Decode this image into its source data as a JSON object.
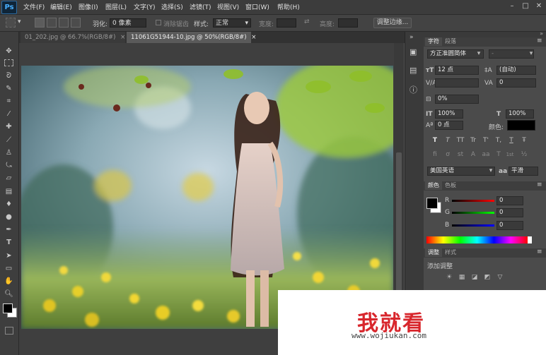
{
  "app": {
    "logo": "Ps"
  },
  "menu": [
    "文件(F)",
    "编辑(E)",
    "图像(I)",
    "图层(L)",
    "文字(Y)",
    "选择(S)",
    "滤镜(T)",
    "视图(V)",
    "窗口(W)",
    "帮助(H)"
  ],
  "window_controls": {
    "minimize": "–",
    "maximize": "□",
    "close": "✕"
  },
  "options": {
    "feather_label": "羽化:",
    "feather_value": "0 像素",
    "antialias_label": "消除锯齿",
    "style_label": "样式:",
    "style_value": "正常",
    "width_label": "宽度:",
    "height_label": "高度:",
    "refine_edge": "调整边缘..."
  },
  "tabs": [
    {
      "label": "01_202.jpg @ 66.7%(RGB/8#)",
      "close": "×"
    },
    {
      "label": "11061G51944-10.jpg @ 50%(RGB/8#)",
      "close": "×"
    }
  ],
  "character": {
    "tabs": [
      "字符",
      "段落"
    ],
    "font_family": "方正准圆简体",
    "font_style": "-",
    "size": "12 点",
    "leading": "(自动)",
    "tracking": "0",
    "scale_label": "0%",
    "vscale": "100%",
    "hscale": "100%",
    "baseline": "0 点",
    "color_label": "颜色:",
    "styles": [
      "T",
      "T",
      "TT",
      "Tr",
      "T'",
      "T,",
      "T",
      "Ŧ"
    ],
    "opentype": [
      "ﬁ",
      "ơ",
      "st",
      "A",
      "aa",
      "T",
      "1st",
      "½"
    ],
    "language": "美国英语",
    "aa_label": "aa",
    "aa_value": "平滑"
  },
  "color_panel": {
    "tabs": [
      "颜色",
      "色板"
    ],
    "channels": [
      {
        "label": "R",
        "value": "0"
      },
      {
        "label": "G",
        "value": "0"
      },
      {
        "label": "B",
        "value": "0"
      }
    ]
  },
  "adjustments": {
    "tabs": [
      "调整",
      "样式"
    ],
    "title": "添加调整",
    "icons_row1": [
      "☀",
      "▦",
      "◪",
      "◩",
      "▽"
    ]
  },
  "watermark": {
    "brand": "我就看",
    "url": "www.wojiukan.com"
  },
  "colors": {
    "accent": "#49b0ff",
    "watermark_red": "#d8262c"
  }
}
